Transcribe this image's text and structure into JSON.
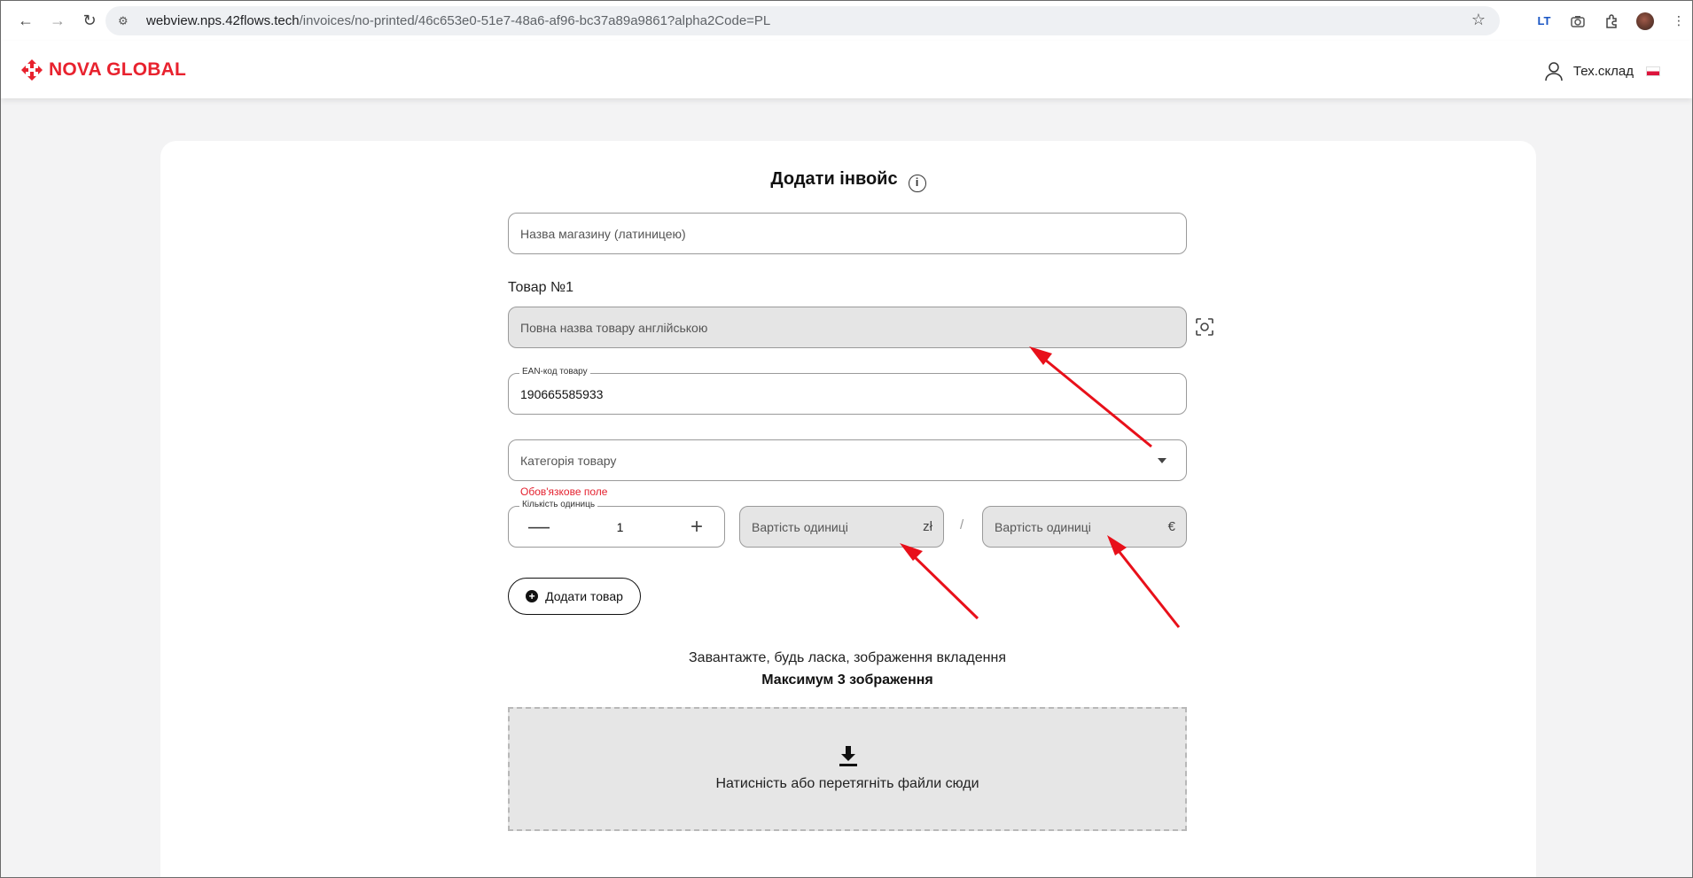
{
  "browser": {
    "url_host": "webview.nps.42flows.tech",
    "url_path": "/invoices/no-printed/46c653e0-51e7-48a6-af96-bc37a89a9861?alpha2Code=PL",
    "extension_label": "LT"
  },
  "header": {
    "logo_text": "NOVA GLOBAL",
    "user_name": "Тех.склад",
    "brand_color": "#e8222e"
  },
  "form": {
    "title": "Додати інвойс",
    "info_icon": "i",
    "shop_name_placeholder": "Назва магазину (латиницею)",
    "product_section_label": "Товар №1",
    "product_name_placeholder": "Повна назва товару англійською",
    "ean_label": "EAN-код товару",
    "ean_value": "190665585933",
    "category_placeholder": "Категорія товару",
    "category_error": "Обов'язкове поле",
    "quantity_label": "Кількість одиниць",
    "quantity_value": "1",
    "quantity_minus": "—",
    "quantity_plus": "+",
    "unit_price_local_placeholder": "Вартість одиниці",
    "unit_price_local_currency": "zł",
    "price_separator": "/",
    "unit_price_eur_placeholder": "Вартість одиниці",
    "unit_price_eur_currency": "€",
    "add_product_button": "Додати товар",
    "add_product_icon": "+"
  },
  "upload": {
    "hint": "Завантажте, будь ласка, зображення вкладення",
    "max_files": "Максимум 3 зображення",
    "dropzone_text": "Натисність або перетягніть файли сюди",
    "cut_off_text": "... . . .. .... .... ."
  },
  "annotation_color": "#e8101a"
}
